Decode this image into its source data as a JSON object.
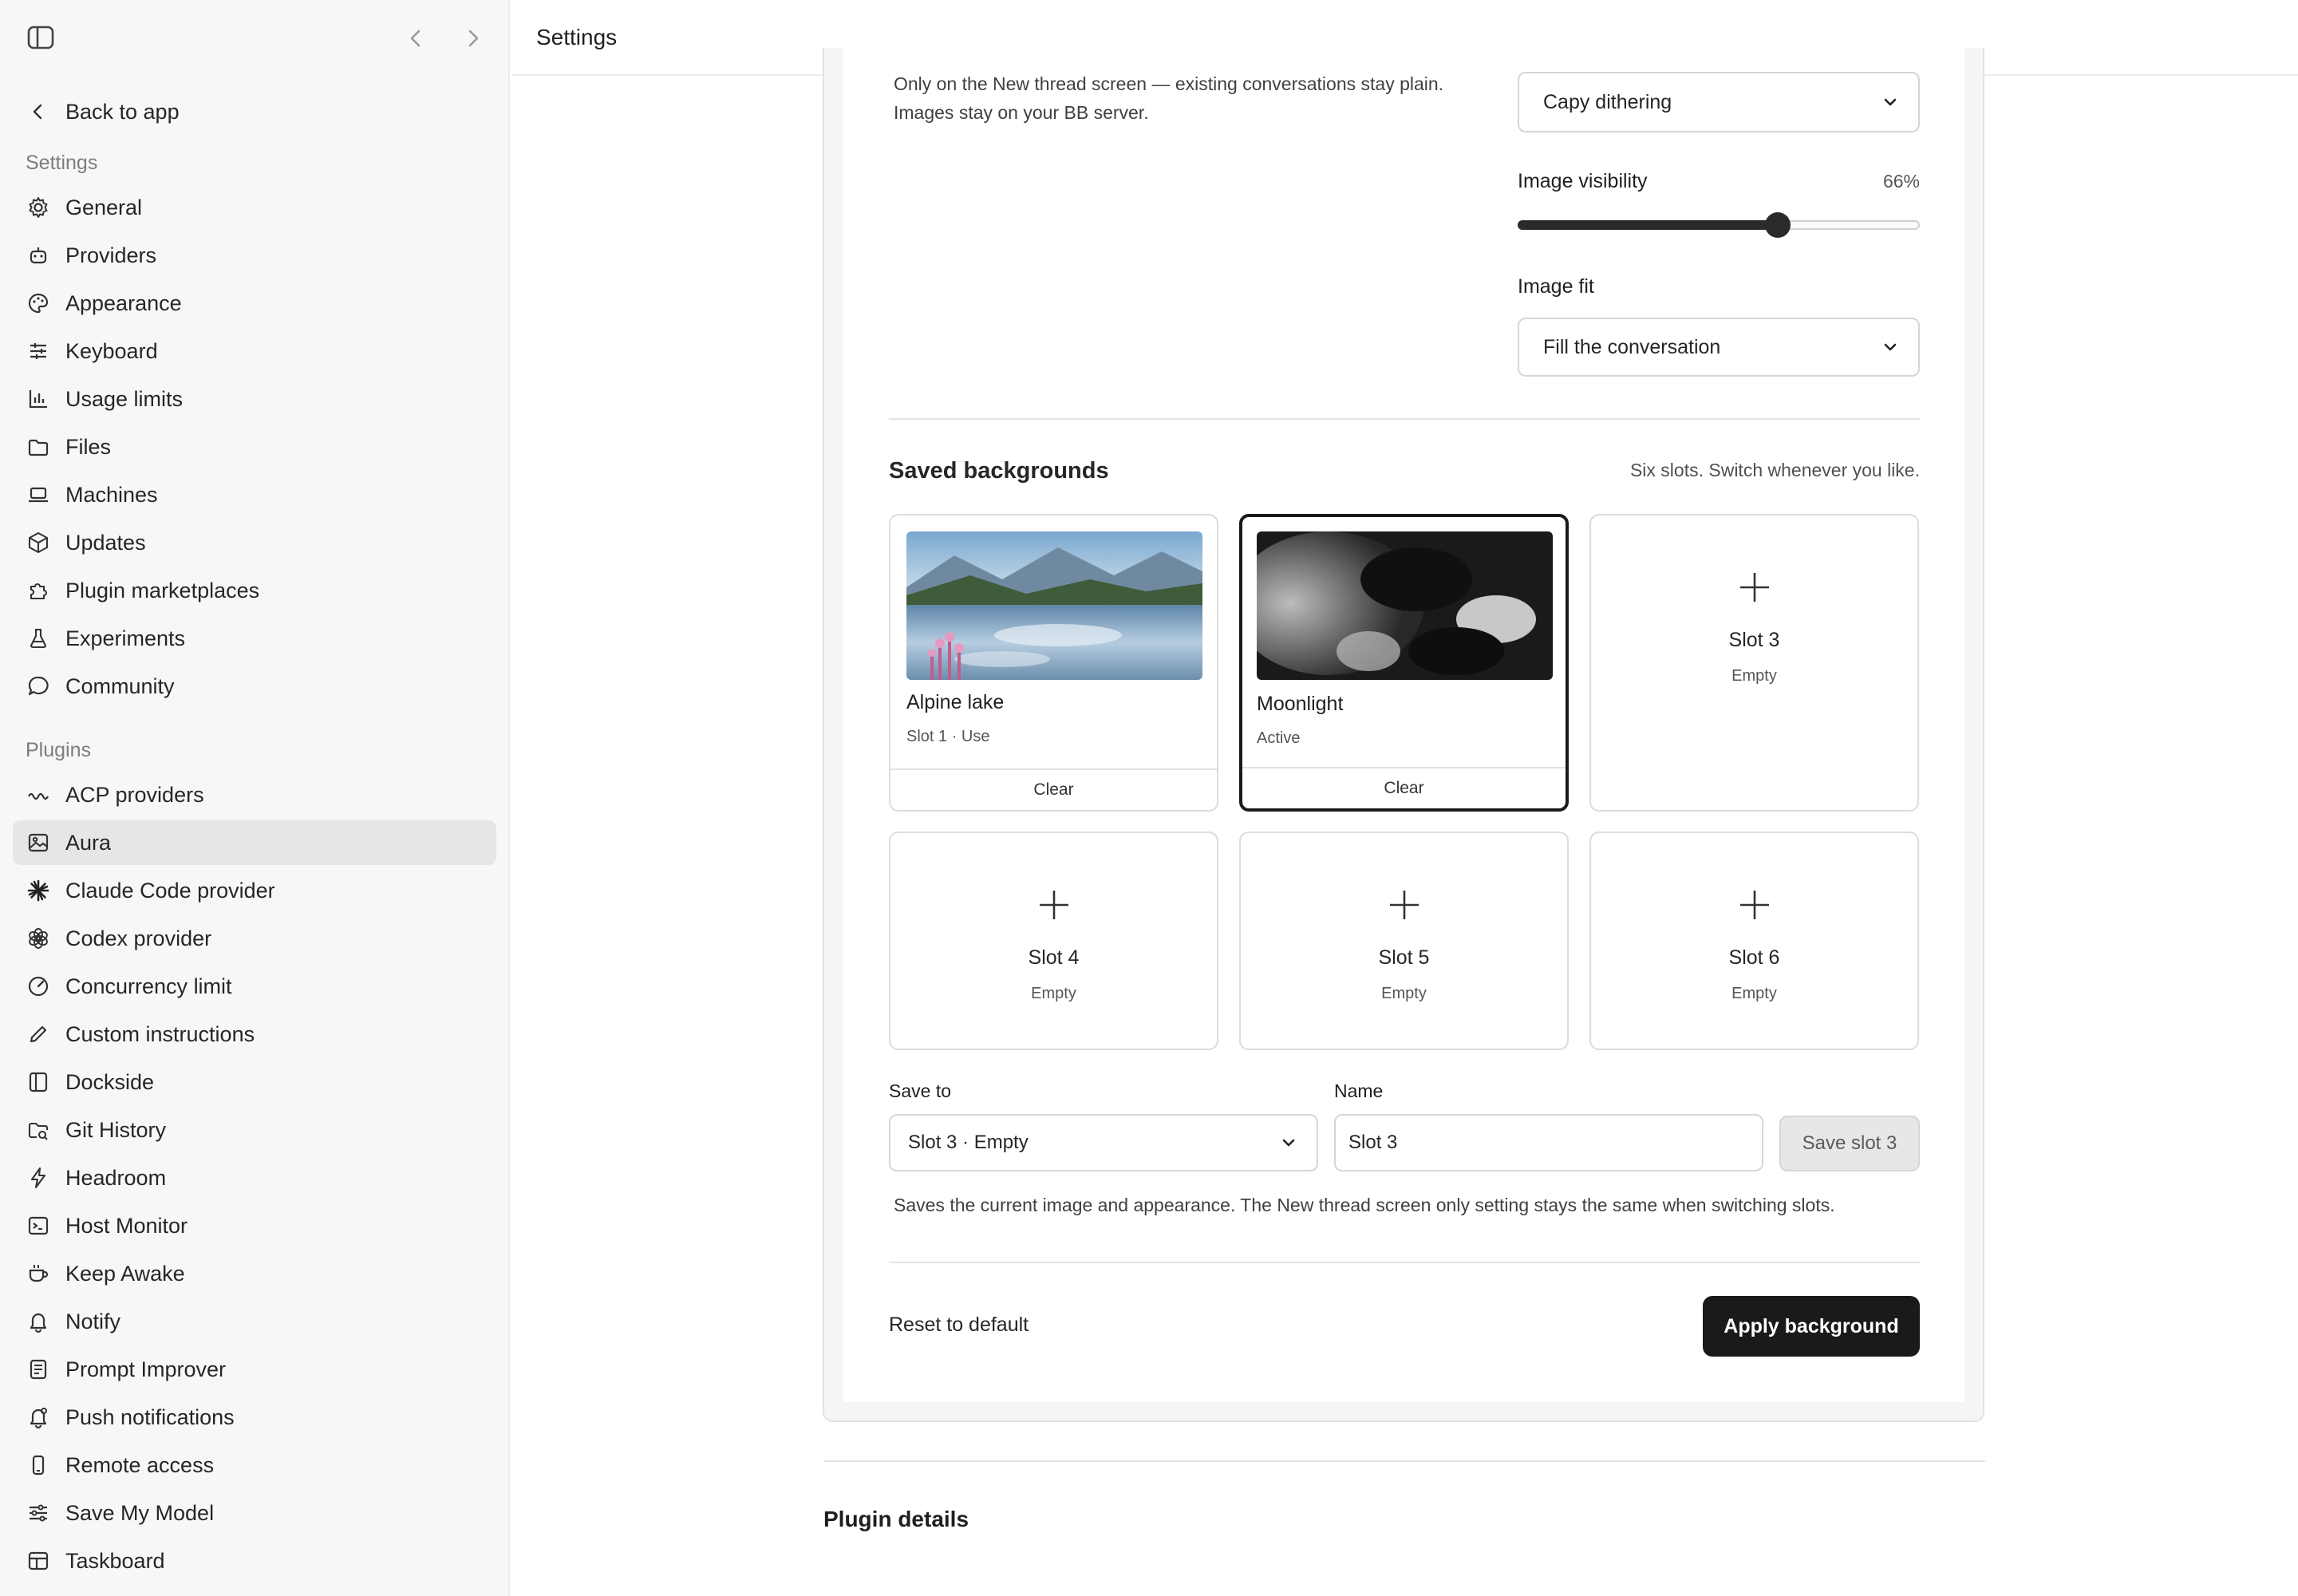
{
  "window": {
    "title": "Settings"
  },
  "sidebar": {
    "back_label": "Back to app",
    "settings_label": "Settings",
    "settings_items": [
      {
        "label": "General",
        "icon": "gear-icon"
      },
      {
        "label": "Providers",
        "icon": "robot-icon"
      },
      {
        "label": "Appearance",
        "icon": "palette-icon"
      },
      {
        "label": "Keyboard",
        "icon": "sliders-icon"
      },
      {
        "label": "Usage limits",
        "icon": "bar-chart-icon"
      },
      {
        "label": "Files",
        "icon": "folder-icon"
      },
      {
        "label": "Machines",
        "icon": "laptop-icon"
      },
      {
        "label": "Updates",
        "icon": "box-icon"
      },
      {
        "label": "Plugin marketplaces",
        "icon": "puzzle-icon"
      },
      {
        "label": "Experiments",
        "icon": "flask-icon"
      },
      {
        "label": "Community",
        "icon": "chat-bubble-icon"
      }
    ],
    "plugins_label": "Plugins",
    "plugin_items": [
      {
        "label": "ACP providers",
        "icon": "wave-icon"
      },
      {
        "label": "Aura",
        "icon": "image-icon",
        "active": true
      },
      {
        "label": "Claude Code provider",
        "icon": "sparkle-icon"
      },
      {
        "label": "Codex provider",
        "icon": "openai-icon"
      },
      {
        "label": "Concurrency limit",
        "icon": "gauge-icon"
      },
      {
        "label": "Custom instructions",
        "icon": "pencil-icon"
      },
      {
        "label": "Dockside",
        "icon": "panel-icon"
      },
      {
        "label": "Git History",
        "icon": "folder-git-icon"
      },
      {
        "label": "Headroom",
        "icon": "bolt-icon"
      },
      {
        "label": "Host Monitor",
        "icon": "terminal-icon"
      },
      {
        "label": "Keep Awake",
        "icon": "coffee-icon"
      },
      {
        "label": "Notify",
        "icon": "bell-icon"
      },
      {
        "label": "Prompt Improver",
        "icon": "document-icon"
      },
      {
        "label": "Push notifications",
        "icon": "bell-ring-icon"
      },
      {
        "label": "Remote access",
        "icon": "phone-icon"
      },
      {
        "label": "Save My Model",
        "icon": "sliders-h-icon"
      },
      {
        "label": "Taskboard",
        "icon": "board-icon"
      }
    ]
  },
  "main": {
    "description_line1": "Only on the New thread screen — existing conversations stay plain.",
    "description_line2": "Images stay on your BB server.",
    "effect_select": "Capy dithering",
    "visibility_label": "Image visibility",
    "visibility_value_text": "66%",
    "visibility_value": 66,
    "fit_label": "Image fit",
    "fit_select": "Fill the conversation",
    "saved_title": "Saved backgrounds",
    "saved_note": "Six slots. Switch whenever you like.",
    "slots": [
      {
        "name": "Alpine lake",
        "meta": "Slot 1 · Use",
        "clear": "Clear"
      },
      {
        "name": "Moonlight",
        "meta": "Active",
        "clear": "Clear"
      },
      {
        "name": "Slot 3",
        "meta": "Empty"
      },
      {
        "name": "Slot 4",
        "meta": "Empty"
      },
      {
        "name": "Slot 5",
        "meta": "Empty"
      },
      {
        "name": "Slot 6",
        "meta": "Empty"
      }
    ],
    "save_to_label": "Save to",
    "save_to_value": "Slot 3 · Empty",
    "name_label": "Name",
    "name_value": "Slot 3",
    "save_button": "Save slot 3",
    "help_text": "Saves the current image and appearance. The New thread screen only setting stays the same when switching slots.",
    "reset_label": "Reset to default",
    "apply_label": "Apply background",
    "plugin_details": "Plugin details"
  },
  "colors": {
    "accent": "#1a1a1a",
    "active_item_bg": "#e6e6e6",
    "sidebar_bg": "#f7f7f7"
  }
}
